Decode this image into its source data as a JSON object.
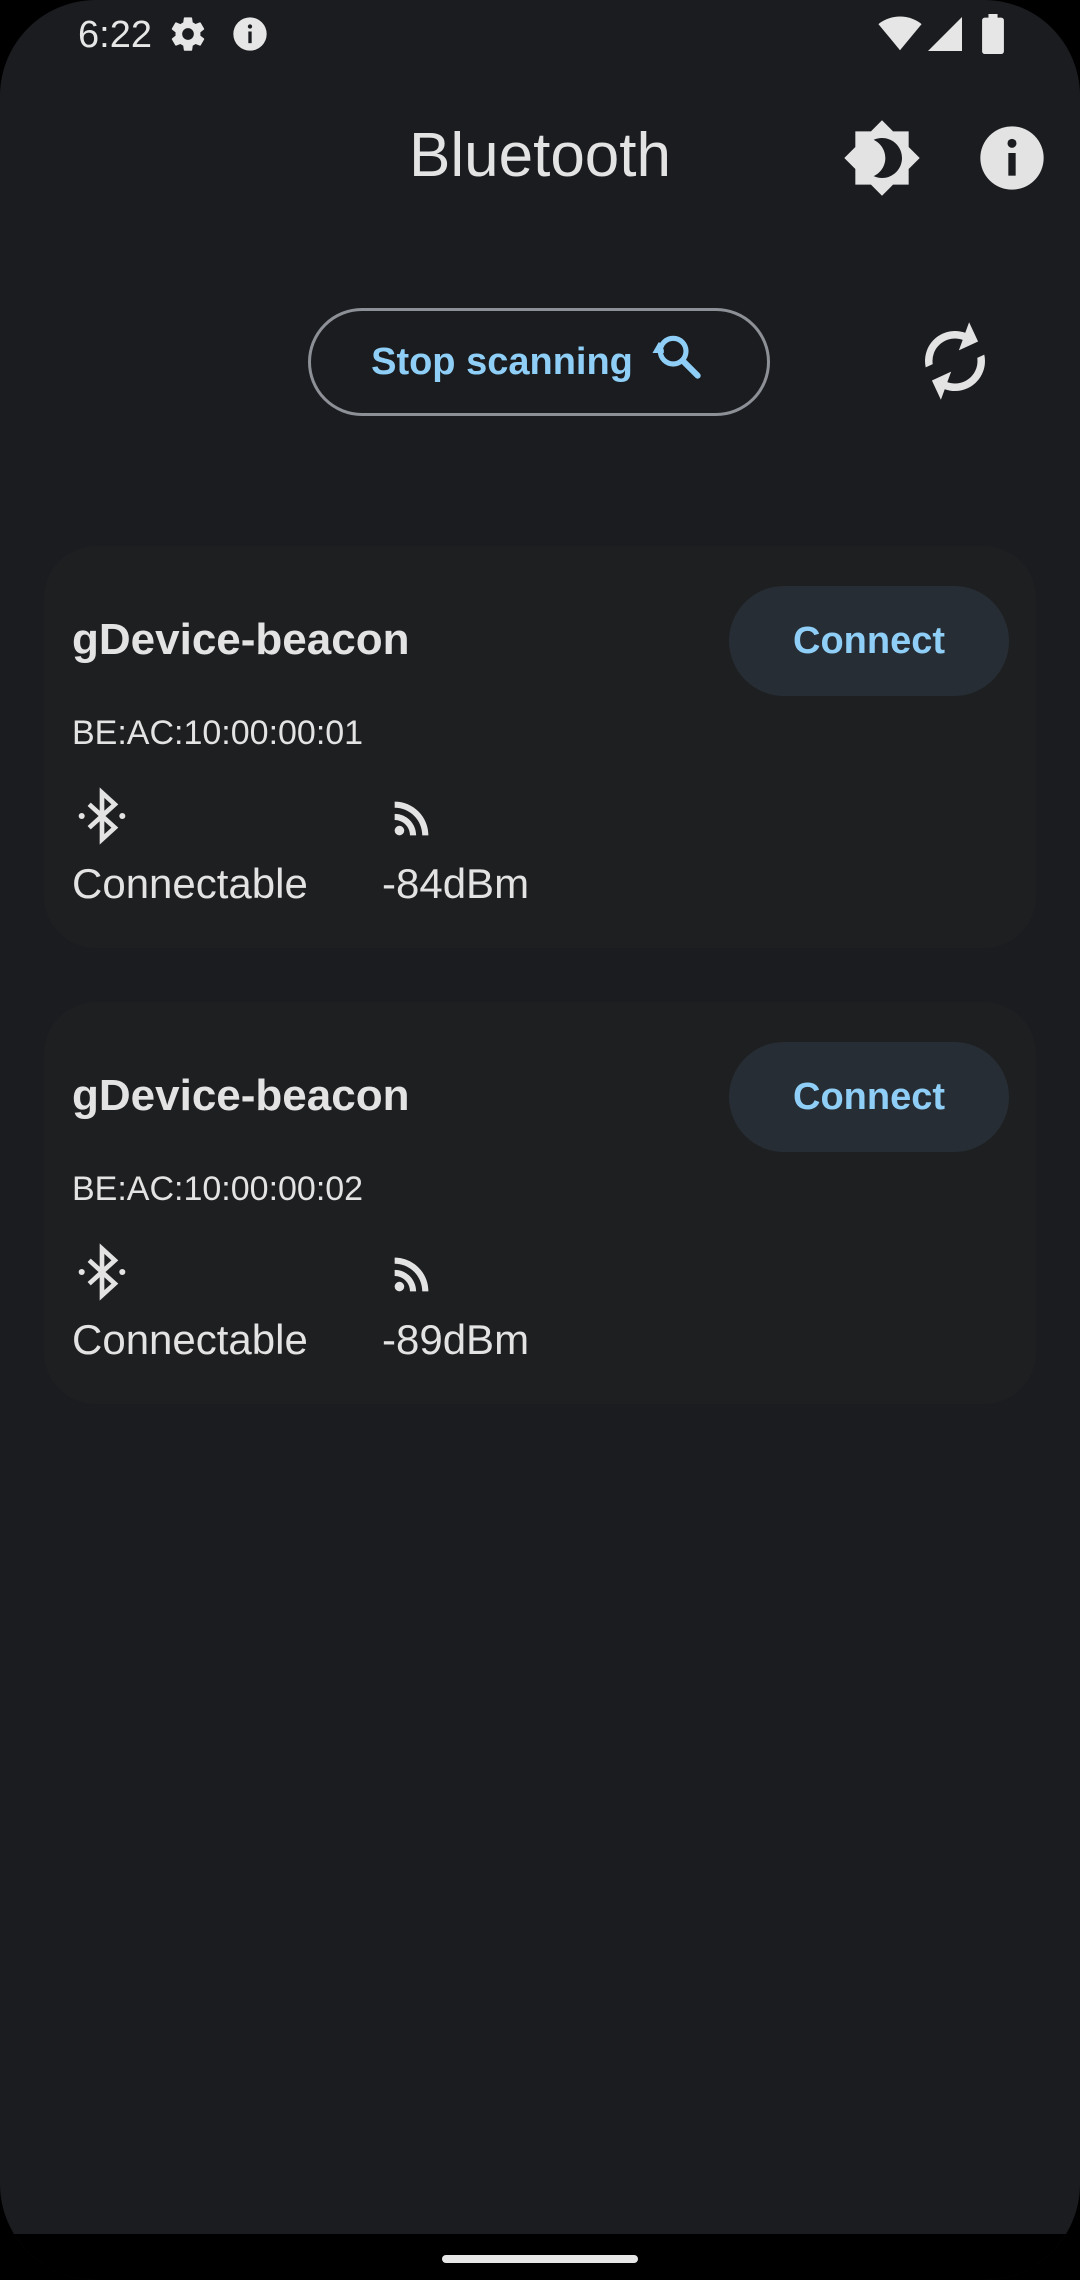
{
  "status_bar": {
    "time": "6:22",
    "left_icons": [
      "settings-icon",
      "info-icon"
    ],
    "right_icons": [
      "wifi-icon",
      "cell-signal-icon",
      "battery-icon"
    ]
  },
  "header": {
    "title": "Bluetooth",
    "actions": [
      "brightness-icon",
      "info-icon"
    ]
  },
  "scan": {
    "label": "Stop scanning",
    "icon": "search-icon",
    "refresh_icon": "refresh-icon"
  },
  "devices": [
    {
      "name": "gDevice-beacon",
      "mac": "BE:AC:10:00:00:01",
      "status": "Connectable",
      "rssi": "-84dBm",
      "connect_label": "Connect"
    },
    {
      "name": "gDevice-beacon",
      "mac": "BE:AC:10:00:00:02",
      "status": "Connectable",
      "rssi": "-89dBm",
      "connect_label": "Connect"
    }
  ],
  "colors": {
    "background": "#1a1c1f",
    "card": "#1e1f21",
    "accent": "#8fcff7",
    "text": "#e3e3e3"
  }
}
